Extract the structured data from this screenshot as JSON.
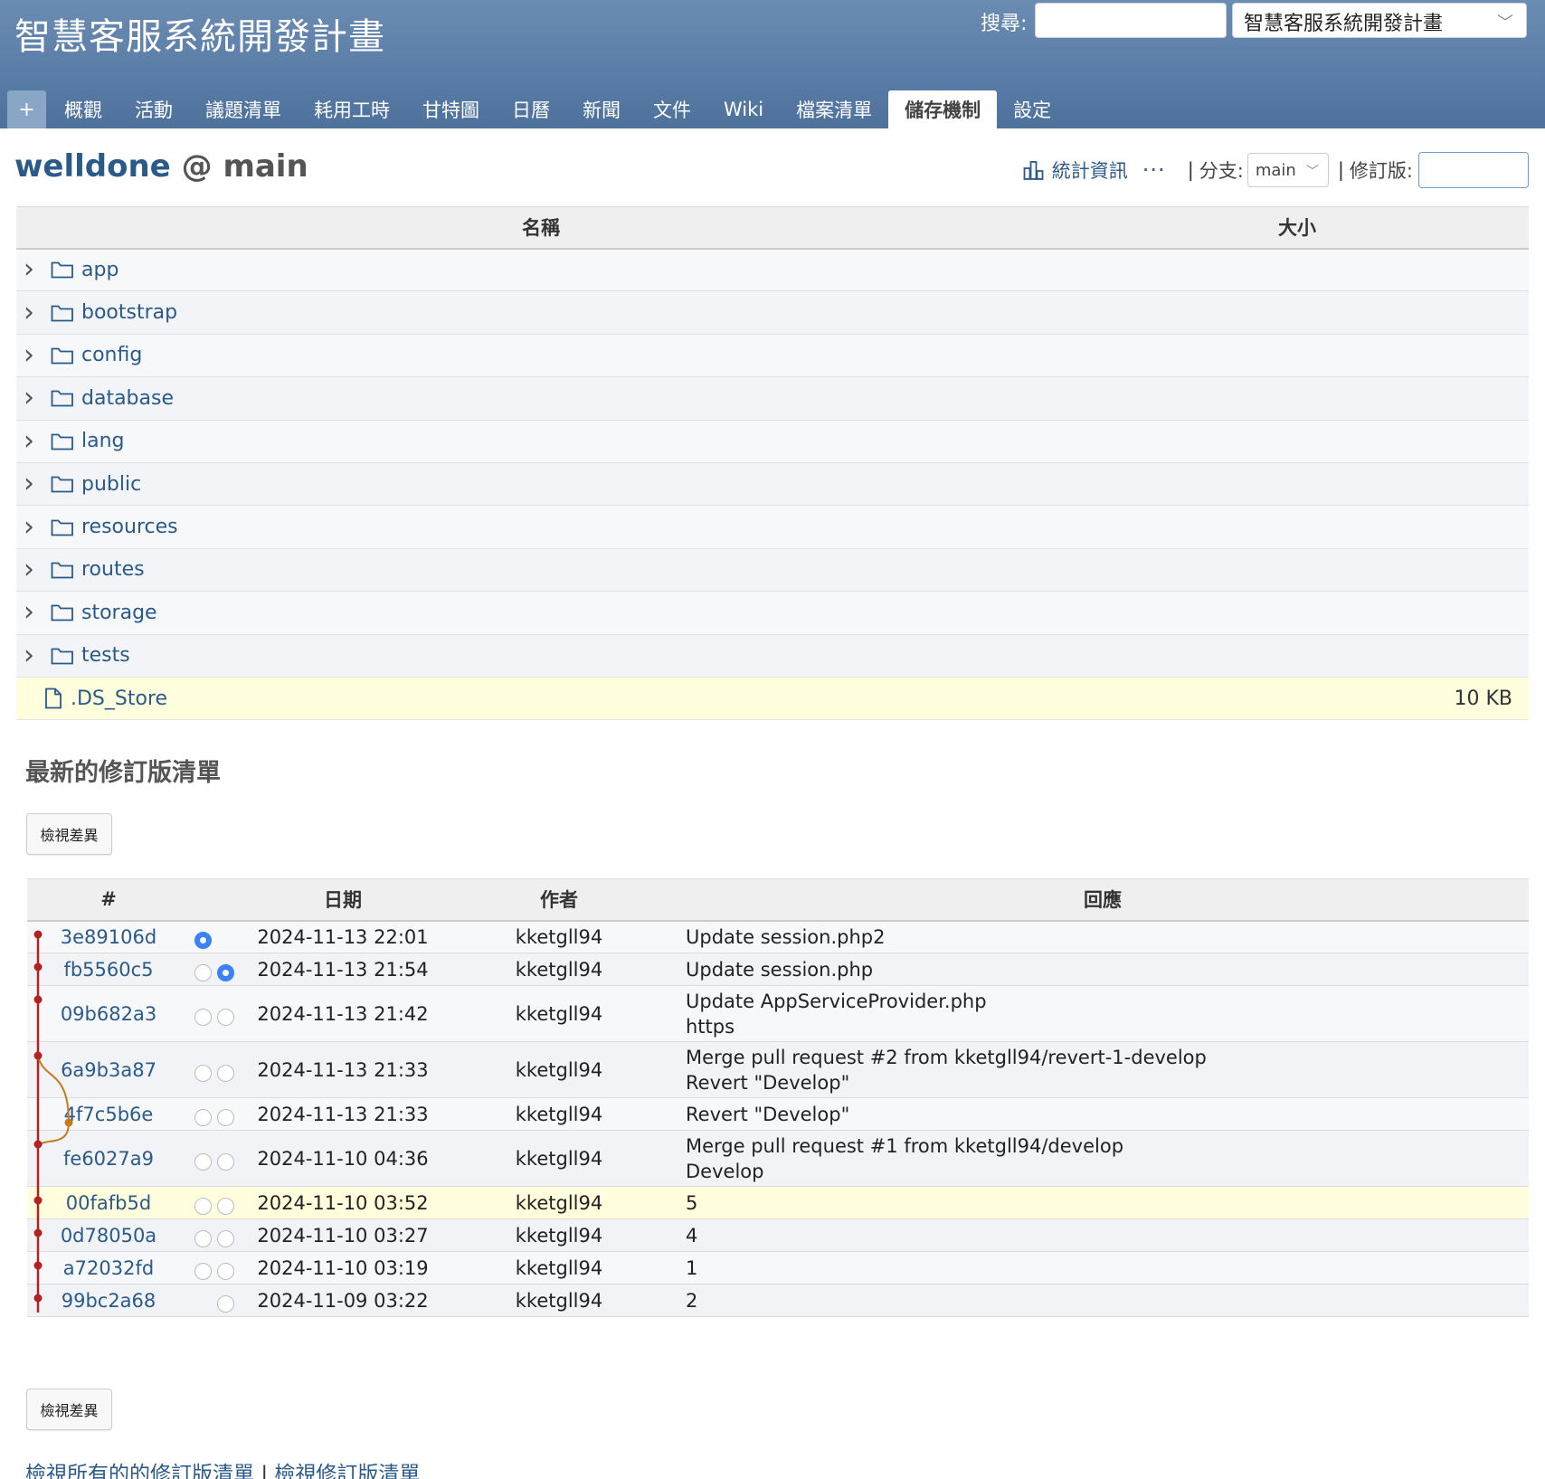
{
  "header": {
    "site_title": "智慧客服系統開發計畫",
    "search_label": "搜尋:",
    "search_value": "",
    "project_select": "智慧客服系統開發計畫"
  },
  "menu": {
    "new_label": "+",
    "tabs": [
      "概觀",
      "活動",
      "議題清單",
      "耗用工時",
      "甘特圖",
      "日曆",
      "新聞",
      "文件",
      "Wiki",
      "檔案清單",
      "儲存機制",
      "設定"
    ],
    "selected": "儲存機制"
  },
  "repository": {
    "name": "welldone",
    "at": "@",
    "branch": "main",
    "stats_label": "統計資訊",
    "more": "···",
    "branch_label": "分支:",
    "revision_label": "修訂版:",
    "sep": "|",
    "revision_value": ""
  },
  "entries": {
    "headers": {
      "name": "名稱",
      "size": "大小"
    },
    "items": [
      {
        "name": "app",
        "kind": "dir",
        "size": ""
      },
      {
        "name": "bootstrap",
        "kind": "dir",
        "size": ""
      },
      {
        "name": "config",
        "kind": "dir",
        "size": ""
      },
      {
        "name": "database",
        "kind": "dir",
        "size": ""
      },
      {
        "name": "lang",
        "kind": "dir",
        "size": ""
      },
      {
        "name": "public",
        "kind": "dir",
        "size": ""
      },
      {
        "name": "resources",
        "kind": "dir",
        "size": ""
      },
      {
        "name": "routes",
        "kind": "dir",
        "size": ""
      },
      {
        "name": "storage",
        "kind": "dir",
        "size": ""
      },
      {
        "name": "tests",
        "kind": "dir",
        "size": ""
      },
      {
        "name": ".DS_Store",
        "kind": "file",
        "size": "10 KB"
      }
    ]
  },
  "revisions": {
    "heading": "最新的修訂版清單",
    "diff_button": "檢視差異",
    "headers": {
      "id": "#",
      "date": "日期",
      "author": "作者",
      "comment": "回應"
    },
    "rows": [
      {
        "id": "3e89106d",
        "date": "2024-11-13 22:01",
        "author": "kketgll94",
        "comment": [
          "Update session.php2"
        ],
        "radios": [
          "on",
          "blank"
        ]
      },
      {
        "id": "fb5560c5",
        "date": "2024-11-13 21:54",
        "author": "kketgll94",
        "comment": [
          "Update session.php"
        ],
        "radios": [
          "off",
          "on"
        ]
      },
      {
        "id": "09b682a3",
        "date": "2024-11-13 21:42",
        "author": "kketgll94",
        "comment": [
          "Update AppServiceProvider.php",
          "https"
        ],
        "radios": [
          "off",
          "off"
        ]
      },
      {
        "id": "6a9b3a87",
        "date": "2024-11-13 21:33",
        "author": "kketgll94",
        "comment": [
          "Merge pull request #2 from kketgll94/revert-1-develop",
          "Revert \"Develop\""
        ],
        "radios": [
          "off",
          "off"
        ]
      },
      {
        "id": "4f7c5b6e",
        "date": "2024-11-13 21:33",
        "author": "kketgll94",
        "comment": [
          "Revert \"Develop\""
        ],
        "radios": [
          "off",
          "off"
        ]
      },
      {
        "id": "fe6027a9",
        "date": "2024-11-10 04:36",
        "author": "kketgll94",
        "comment": [
          "Merge pull request #1 from kketgll94/develop",
          "Develop"
        ],
        "radios": [
          "off",
          "off"
        ]
      },
      {
        "id": "00fafb5d",
        "date": "2024-11-10 03:52",
        "author": "kketgll94",
        "comment": [
          "5"
        ],
        "radios": [
          "off",
          "off"
        ],
        "highlight": true
      },
      {
        "id": "0d78050a",
        "date": "2024-11-10 03:27",
        "author": "kketgll94",
        "comment": [
          "4"
        ],
        "radios": [
          "off",
          "off"
        ]
      },
      {
        "id": "a72032fd",
        "date": "2024-11-10 03:19",
        "author": "kketgll94",
        "comment": [
          "1"
        ],
        "radios": [
          "off",
          "off"
        ]
      },
      {
        "id": "99bc2a68",
        "date": "2024-11-09 03:22",
        "author": "kketgll94",
        "comment": [
          "2"
        ],
        "radios": [
          "blank",
          "off"
        ]
      }
    ]
  },
  "footer": {
    "view_all": "檢視所有的的修訂版清單",
    "sep": "|",
    "view_revisions": "檢視修訂版清單"
  },
  "colors": {
    "header_bg": "#5b7ea8",
    "link": "#2a5a8a",
    "graph_main": "#b22222",
    "graph_branch": "#c8781e",
    "highlight_row": "#ffffdd"
  }
}
